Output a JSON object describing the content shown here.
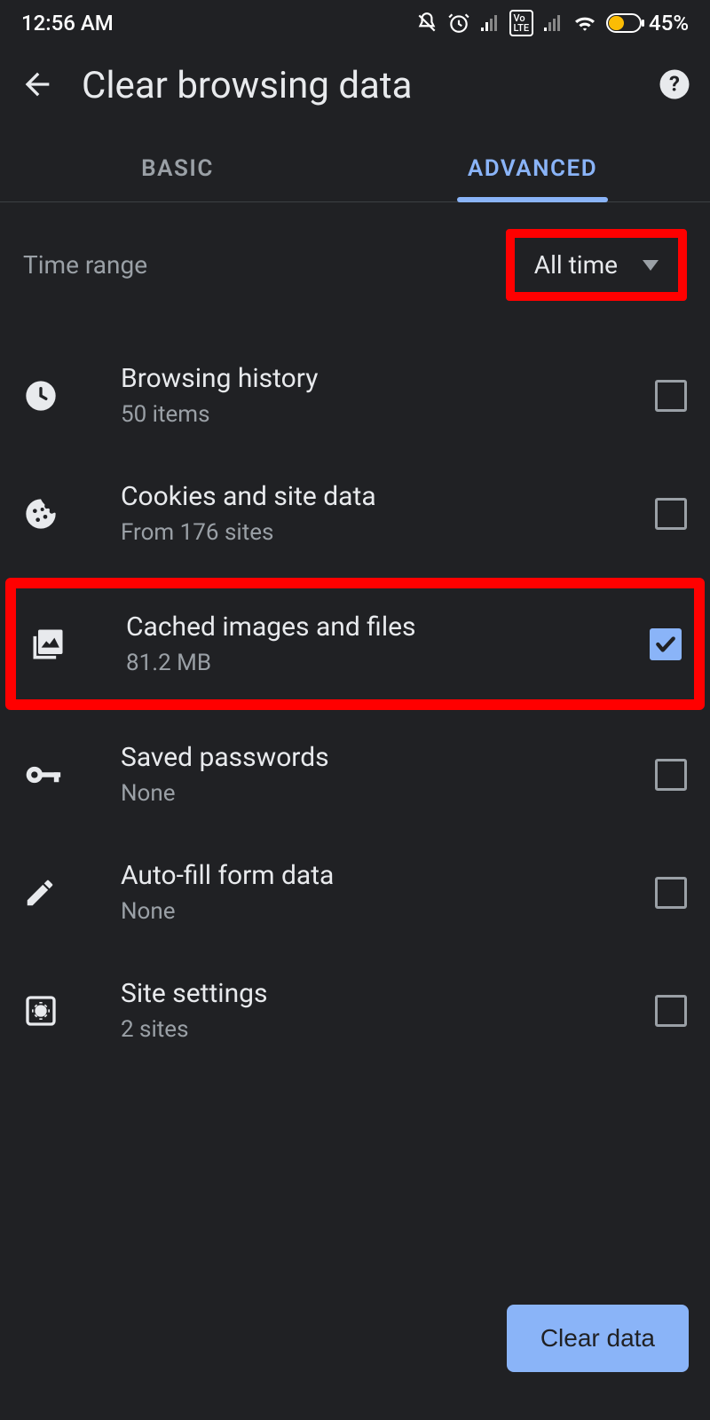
{
  "status": {
    "time": "12:56 AM",
    "battery": "45%"
  },
  "header": {
    "title": "Clear browsing data"
  },
  "tabs": {
    "basic": "BASIC",
    "advanced": "ADVANCED"
  },
  "timeRange": {
    "label": "Time range",
    "value": "All time"
  },
  "items": [
    {
      "title": "Browsing history",
      "sub": "50 items",
      "checked": false
    },
    {
      "title": "Cookies and site data",
      "sub": "From 176 sites",
      "checked": false
    },
    {
      "title": "Cached images and files",
      "sub": "81.2 MB",
      "checked": true
    },
    {
      "title": "Saved passwords",
      "sub": "None",
      "checked": false
    },
    {
      "title": "Auto-fill form data",
      "sub": "None",
      "checked": false
    },
    {
      "title": "Site settings",
      "sub": "2 sites",
      "checked": false
    }
  ],
  "footer": {
    "clear": "Clear data"
  }
}
